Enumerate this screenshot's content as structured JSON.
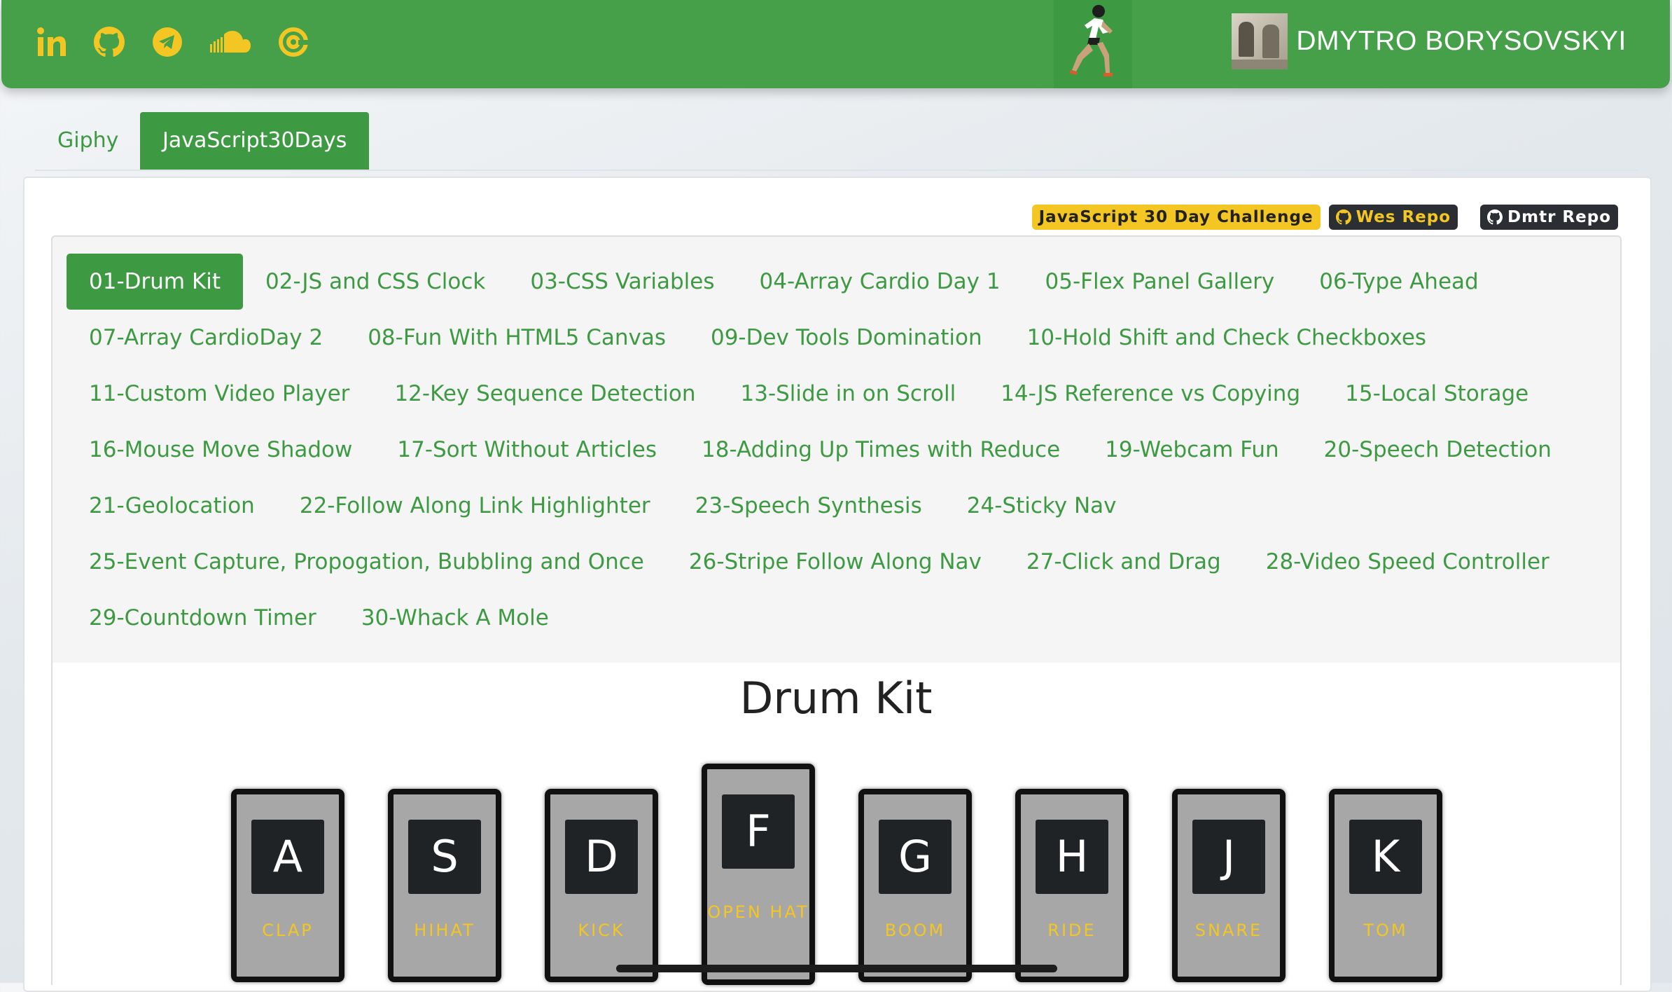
{
  "header": {
    "social_icons": [
      "linkedin-icon",
      "github-icon",
      "telegram-icon",
      "soundcloud-icon",
      "email-at-icon"
    ],
    "icon_color": "#f3c623",
    "bar_color": "#46a04a",
    "author_name": "DMYTRO BORYSOVSKYI"
  },
  "top_tabs": [
    {
      "label": "Giphy",
      "active": false
    },
    {
      "label": "JavaScript30Days",
      "active": true
    }
  ],
  "badges": {
    "challenge": "JavaScript 30 Day Challenge",
    "wes_repo": "Wes Repo",
    "dmtr_repo": "Dmtr Repo"
  },
  "lessons": [
    "01-Drum Kit",
    "02-JS and CSS Clock",
    "03-CSS Variables",
    "04-Array Cardio Day 1",
    "05-Flex Panel Gallery",
    "06-Type Ahead",
    "07-Array CardioDay 2",
    "08-Fun With HTML5 Canvas",
    "09-Dev Tools Domination",
    "10-Hold Shift and Check Checkboxes",
    "11-Custom Video Player",
    "12-Key Sequence Detection",
    "13-Slide in on Scroll",
    "14-JS Reference vs Copying",
    "15-Local Storage",
    "16-Mouse Move Shadow",
    "17-Sort Without Articles",
    "18-Adding Up Times with Reduce",
    "19-Webcam Fun",
    "20-Speech Detection",
    "21-Geolocation",
    "22-Follow Along Link Highlighter",
    "23-Speech Synthesis",
    "24-Sticky Nav",
    "25-Event Capture, Propogation, Bubbling and Once",
    "26-Stripe Follow Along Nav",
    "27-Click and Drag",
    "28-Video Speed Controller",
    "29-Countdown Timer",
    "30-Whack A Mole"
  ],
  "active_lesson": "01-Drum Kit",
  "drum_kit": {
    "title": "Drum Kit",
    "keys": [
      {
        "key": "A",
        "sound": "CLAP"
      },
      {
        "key": "S",
        "sound": "HIHAT"
      },
      {
        "key": "D",
        "sound": "KICK"
      },
      {
        "key": "F",
        "sound": "OPEN HAT",
        "playing": true
      },
      {
        "key": "G",
        "sound": "BOOM"
      },
      {
        "key": "H",
        "sound": "RIDE"
      },
      {
        "key": "J",
        "sound": "SNARE"
      },
      {
        "key": "K",
        "sound": "TOM"
      }
    ]
  }
}
